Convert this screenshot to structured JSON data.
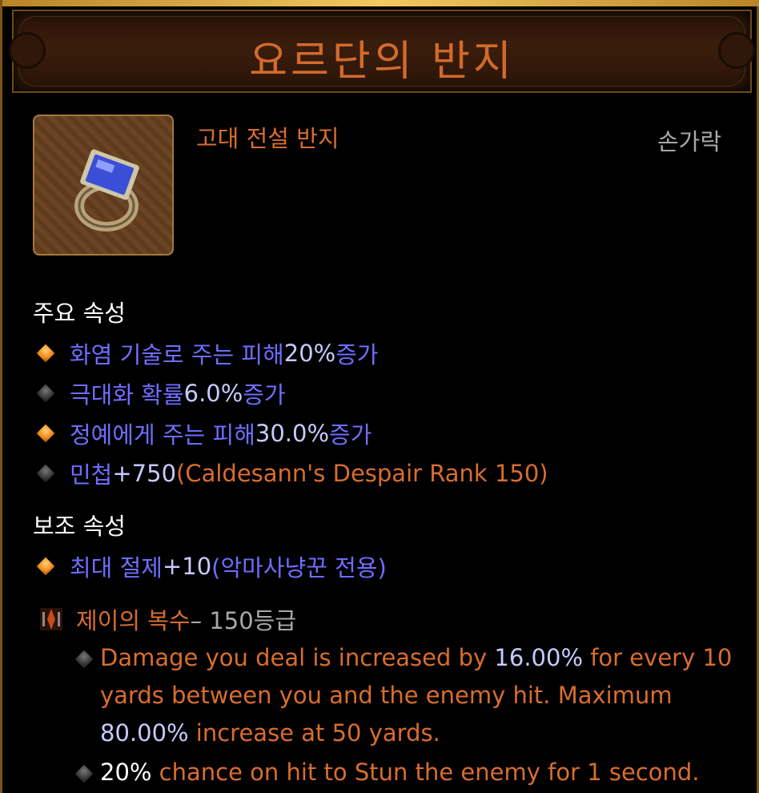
{
  "title": "요르단의 반지",
  "item": {
    "type": "고대 전설 반지",
    "slot": "손가락",
    "icon": "ring-icon"
  },
  "primary": {
    "heading": "주요 속성",
    "stats": [
      {
        "text": "화염 기술로 주는 피해 ",
        "value": "20%",
        "suffix": " 증가",
        "bullet": "orange"
      },
      {
        "text": "극대화 확률 ",
        "value": "6.0%",
        "suffix": " 증가",
        "bullet": "gray"
      },
      {
        "text": "정예에게 주는 피해 ",
        "value": "30.0%",
        "suffix": " 증가",
        "bullet": "orange"
      },
      {
        "text": "민첩 ",
        "value": "+750",
        "suffix": " (Caldesann's Despair Rank 150)",
        "bullet": "gray"
      }
    ]
  },
  "secondary": {
    "heading": "보조 속성",
    "stats": [
      {
        "text": "최대 절제 ",
        "value": "+10",
        "suffix": " (악마사냥꾼 전용)",
        "bullet": "orange"
      }
    ]
  },
  "legendary": {
    "name": "제이의 복수",
    "rank": " – 150등급",
    "icon": "legendary-gem-icon",
    "desc1": {
      "a": "Damage you deal is increased by ",
      "v1": "16.00%",
      "b": " for every 10",
      "c": "yards between you and the enemy hit. Maximum",
      "v2": "80.00%",
      "d": " increase at 50 yards."
    },
    "desc2": {
      "v": "20%",
      "a": " chance on hit to Stun the enemy for 1 second."
    }
  },
  "colors": {
    "orange": "#d96d2f",
    "blue": "#6e6eff",
    "gold": "#b98526"
  }
}
